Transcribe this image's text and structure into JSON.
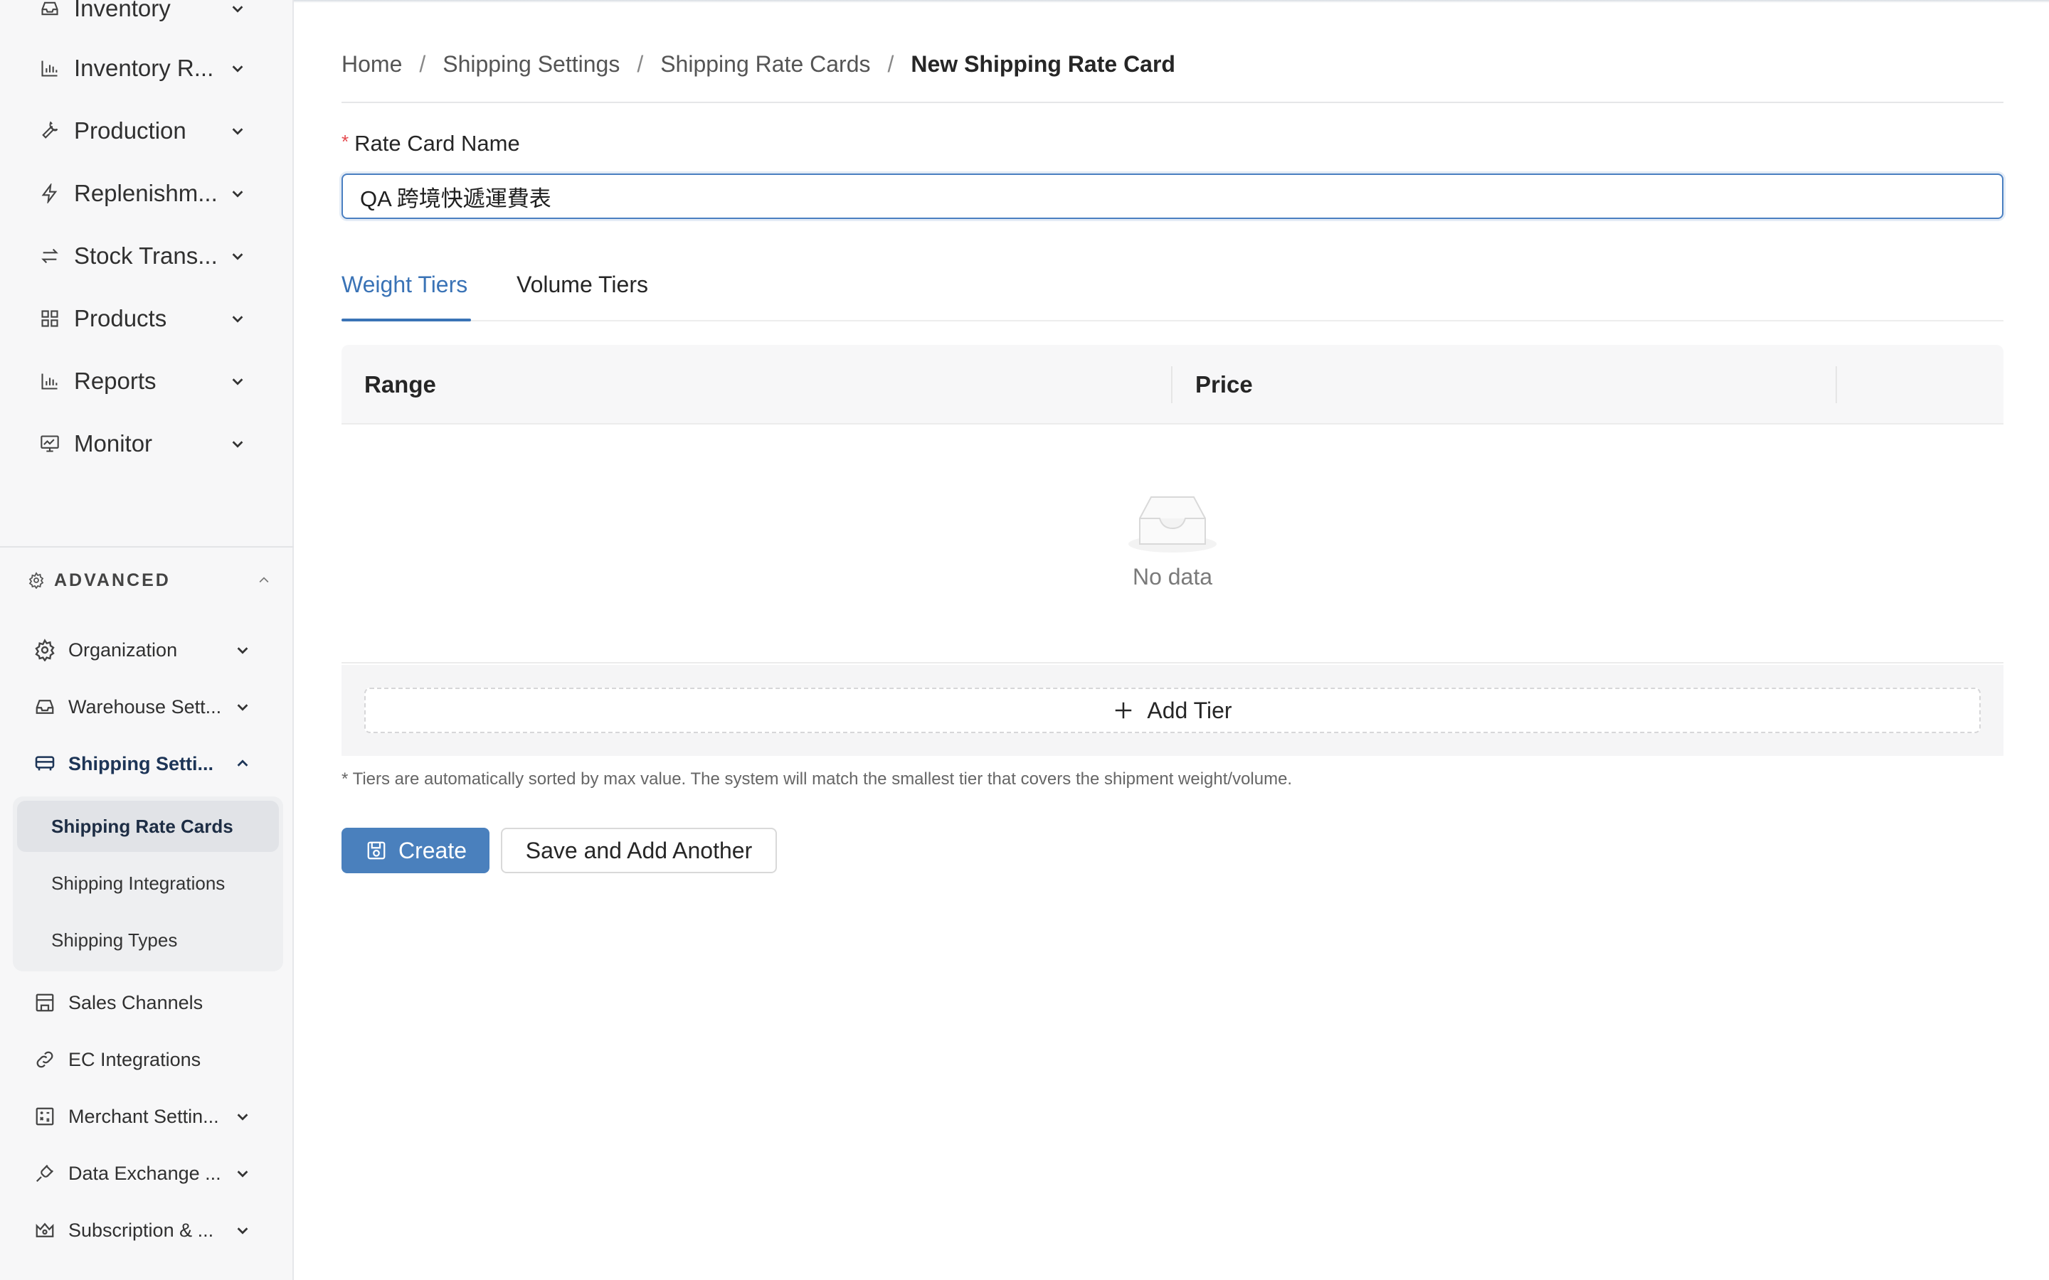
{
  "sidebar": {
    "nav_items": [
      {
        "label": "Inventory",
        "icon": "inbox-icon"
      },
      {
        "label": "Inventory R...",
        "icon": "bar-chart-icon"
      },
      {
        "label": "Production",
        "icon": "wrench-icon"
      },
      {
        "label": "Replenishm...",
        "icon": "lightning-icon"
      },
      {
        "label": "Stock Trans...",
        "icon": "transfer-arrows-icon"
      },
      {
        "label": "Products",
        "icon": "grid-icon"
      },
      {
        "label": "Reports",
        "icon": "bar-chart-icon"
      },
      {
        "label": "Monitor",
        "icon": "monitor-icon"
      }
    ],
    "advanced_label": "ADVANCED",
    "advanced_items": [
      {
        "label": "Organization",
        "icon": "gear-icon"
      },
      {
        "label": "Warehouse Sett...",
        "icon": "inbox-icon"
      },
      {
        "label": "Shipping Setti...",
        "icon": "truck-icon"
      }
    ],
    "shipping_subitems": [
      {
        "label": "Shipping Rate Cards"
      },
      {
        "label": "Shipping Integrations"
      },
      {
        "label": "Shipping Types"
      }
    ],
    "lower_items": [
      {
        "label": "Sales Channels",
        "icon": "store-icon"
      },
      {
        "label": "EC Integrations",
        "icon": "link-icon"
      },
      {
        "label": "Merchant Settin...",
        "icon": "calculator-icon"
      },
      {
        "label": "Data Exchange ...",
        "icon": "plug-icon"
      },
      {
        "label": "Subscription & ...",
        "icon": "crown-icon"
      }
    ]
  },
  "breadcrumb": {
    "items": [
      "Home",
      "Shipping Settings",
      "Shipping Rate Cards"
    ],
    "current": "New Shipping Rate Card",
    "separator": "/"
  },
  "form": {
    "required_mark": "*",
    "name_label": "Rate Card Name",
    "name_value": "QA 跨境快遞運費表"
  },
  "tabs": {
    "items": [
      "Weight Tiers",
      "Volume Tiers"
    ],
    "active": "Weight Tiers"
  },
  "table": {
    "columns": [
      "Range",
      "Price"
    ],
    "empty_text": "No data"
  },
  "add_tier_label": "Add Tier",
  "note": "* Tiers are automatically sorted by max value. The system will match the smallest tier that covers the shipment weight/volume.",
  "actions": {
    "create_label": "Create",
    "save_another_label": "Save and Add Another"
  },
  "colors": {
    "accent": "#4a80bd",
    "tab_active": "#3a73b6",
    "required": "#e5484d"
  }
}
